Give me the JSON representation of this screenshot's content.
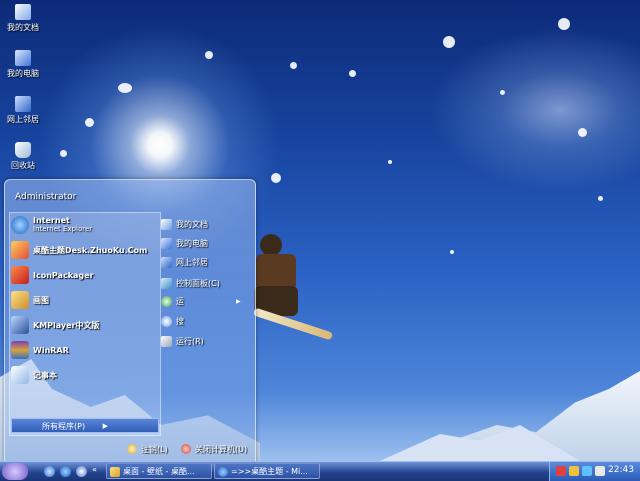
{
  "desktop": {
    "icons": [
      {
        "label": "我的文档",
        "icon": "my-documents-icon"
      },
      {
        "label": "我的电脑",
        "icon": "my-computer-icon"
      },
      {
        "label": "网上邻居",
        "icon": "network-places-icon"
      },
      {
        "label": "回收站",
        "icon": "recycle-bin-icon"
      }
    ]
  },
  "start_menu": {
    "user": "Administrator",
    "left_items": [
      {
        "title": "Internet",
        "subtitle": "Internet Explorer",
        "icon": "internet-explorer-icon"
      },
      {
        "title": "桌酷主题Desk.ZhuoKu.Com",
        "icon": "zhuoku-theme-icon"
      },
      {
        "title": "IconPackager",
        "icon": "iconpackager-icon"
      },
      {
        "title": "画图",
        "icon": "paint-icon"
      },
      {
        "title": "KMPlayer中文版",
        "icon": "kmplayer-icon"
      },
      {
        "title": "WinRAR",
        "icon": "winrar-icon"
      },
      {
        "title": "记事本",
        "icon": "notepad-icon"
      }
    ],
    "all_programs": "所有程序(P)",
    "right_items": [
      {
        "label": "我的文档",
        "icon": "my-documents-icon"
      },
      {
        "label": "我的电脑",
        "icon": "my-computer-icon"
      },
      {
        "label": "网上邻居",
        "icon": "network-places-icon"
      },
      {
        "label": "控制面板(C)",
        "icon": "control-panel-icon"
      },
      {
        "label": "运",
        "icon": "run-icon"
      },
      {
        "label": "搜",
        "icon": "search-icon"
      },
      {
        "label": "运行(R)",
        "icon": "run-icon"
      }
    ],
    "logoff": "注销(L)",
    "shutdown": "关闭计算机(U)"
  },
  "taskbar": {
    "tasks": [
      {
        "label": "桌面 - 壁纸 - 桌酷...",
        "icon": "folder-icon"
      },
      {
        "label": "=>>桌酷主题 - Mi...",
        "icon": "browser-icon"
      }
    ],
    "clock": "22:43"
  }
}
